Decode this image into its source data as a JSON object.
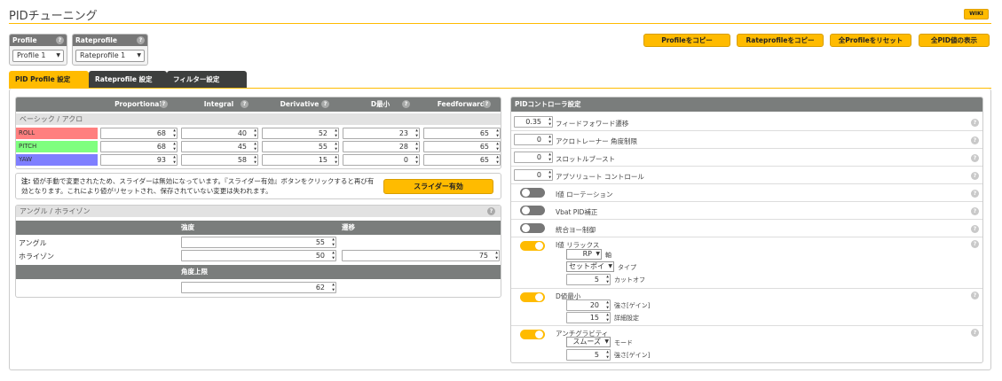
{
  "title": "PIDチューニング",
  "wiki": "WIKI",
  "profile": {
    "label": "Profile",
    "value": "Profile 1"
  },
  "rateprofile": {
    "label": "Rateprofile",
    "value": "Rateprofile 1"
  },
  "buttons": {
    "copy_profile": "Profileをコピー",
    "copy_rateprofile": "Rateprofileをコピー",
    "reset_all": "全Profileをリセット",
    "show_all": "全PID値の表示"
  },
  "tabs": [
    "PID Profile 設定",
    "Rateprofile 設定",
    "フィルター設定"
  ],
  "pid_table": {
    "headers": [
      "Proportional",
      "Integral",
      "Derivative",
      "D最小",
      "Feedforward"
    ],
    "section": "ベーシック / アクロ",
    "rows": [
      {
        "name": "ROLL",
        "color": "#ff7f7f",
        "values": [
          "68",
          "40",
          "52",
          "23",
          "65"
        ]
      },
      {
        "name": "PITCH",
        "color": "#7fff7f",
        "values": [
          "68",
          "45",
          "55",
          "28",
          "65"
        ]
      },
      {
        "name": "YAW",
        "color": "#7f7fff",
        "values": [
          "93",
          "58",
          "15",
          "0",
          "65"
        ]
      }
    ]
  },
  "note": {
    "bold": "注:",
    "text": " 値が手動で変更されたため、スライダーは無効になっています。『スライダー有効』ボタンをクリックすると再び有効となります。これにより値がリセットされ、保存されていない変更は失われます。",
    "button": "スライダー有効"
  },
  "angle": {
    "section": "アングル / ホライゾン",
    "strength": "強度",
    "transition": "遷移",
    "angle_label": "アングル",
    "angle_value": "55",
    "horizon_label": "ホライゾン",
    "horizon_value": "50",
    "horizon_transition": "75",
    "limit": "角度上限",
    "limit_value": "62"
  },
  "controller": {
    "title": "PIDコントローラ設定",
    "ff_value": "0.35",
    "ff_label": "フィードフォワード遷移",
    "acro_value": "0",
    "acro_label": "アクロトレーナー 角度制限",
    "throttle_value": "0",
    "throttle_label": "スロットルブースト",
    "absolute_value": "0",
    "absolute_label": "アブソリュート コントロール",
    "i_term_rot": "I値 ローテーション",
    "vbat": "Vbat PID補正",
    "yaw_limit": "統合ヨー制御",
    "i_relax": "I値 リラックス",
    "i_relax_axis": "RP",
    "axis_label": "軸",
    "i_relax_type": "セットポイ",
    "type_label": "タイプ",
    "i_relax_cutoff": "5",
    "cutoff_label": "カットオフ",
    "dmin": "D値最小",
    "dmin_gain": "20",
    "gain_label": "強さ[ゲイン]",
    "dmin_advance": "15",
    "advance_label": "詳細設定",
    "antigravity": "アンチグラビティ",
    "ag_mode": "スムーズ",
    "mode_label": "モード",
    "ag_gain": "5",
    "ag_gain_label": "強さ[ゲイン]"
  }
}
